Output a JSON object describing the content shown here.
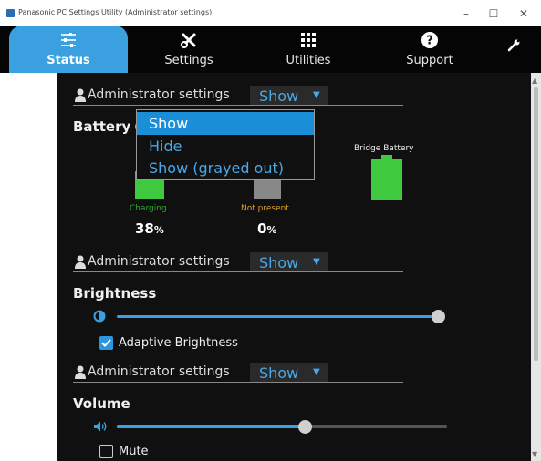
{
  "window": {
    "title": "Panasonic PC Settings Utility (Administrator settings)",
    "minimize": "–",
    "maximize": "☐",
    "close": "✕"
  },
  "tabs": [
    {
      "label": "Status",
      "icon": "sliders-icon",
      "active": true
    },
    {
      "label": "Settings",
      "icon": "tools-icon",
      "active": false
    },
    {
      "label": "Utilities",
      "icon": "grid-icon",
      "active": false
    },
    {
      "label": "Support",
      "icon": "help-icon",
      "active": false
    },
    {
      "label": "",
      "icon": "wrench-icon",
      "active": false
    }
  ],
  "admin_settings": {
    "label": "Administrator settings",
    "rows": [
      {
        "value": "Show"
      },
      {
        "value": "Show"
      },
      {
        "value": "Show"
      }
    ]
  },
  "dropdown": {
    "options": [
      "Show",
      "Hide",
      "Show (grayed out)"
    ],
    "selected": "Show"
  },
  "battery": {
    "title": "Battery",
    "main": {
      "status": "Charging",
      "percent": "38",
      "unit": "%",
      "level": 0.38,
      "color": "#3ec93e"
    },
    "secondary": {
      "status": "Not present",
      "percent": "0",
      "unit": "%",
      "level": 0
    },
    "bridge": {
      "label": "Bridge Battery",
      "level": 1.0,
      "color": "#3ec93e"
    }
  },
  "brightness": {
    "title": "Brightness",
    "level": 1.0,
    "adaptive_label": "Adaptive Brightness",
    "adaptive_checked": true
  },
  "volume": {
    "title": "Volume",
    "level": 0.57,
    "mute_label": "Mute",
    "mute_checked": false
  },
  "colors": {
    "accent": "#3aa0e0",
    "link": "#48a8e8",
    "charging": "#2fa82f",
    "not_present": "#e0a020"
  }
}
